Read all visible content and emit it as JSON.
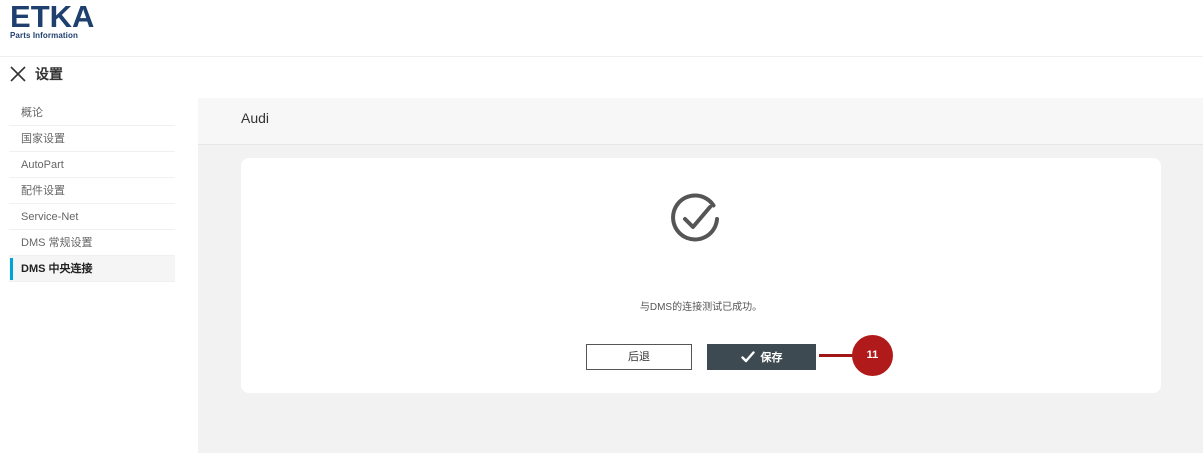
{
  "logo": {
    "mark_letters": [
      "E",
      "TKA"
    ],
    "subtitle": "Parts Information"
  },
  "settings": {
    "title": "设置"
  },
  "sidebar": {
    "items": [
      {
        "label": "概论"
      },
      {
        "label": "国家设置"
      },
      {
        "label": "AutoPart"
      },
      {
        "label": "配件设置"
      },
      {
        "label": "Service-Net"
      },
      {
        "label": "DMS 常规设置"
      },
      {
        "label": "DMS 中央连接",
        "active": true
      }
    ]
  },
  "main": {
    "brand": "Audi",
    "dialog": {
      "message": "与DMS的连接测试已成功。",
      "back_label": "后退",
      "save_label": "保存"
    }
  },
  "callout": {
    "number": "11"
  },
  "colors": {
    "brand_blue": "#1f3f6e",
    "active_indicator": "#00a3d9",
    "save_button": "#3d4a52",
    "callout_red": "#b01a1a"
  },
  "icons": {
    "close": "close-icon",
    "success": "success-check-icon",
    "save_check": "check-icon"
  }
}
